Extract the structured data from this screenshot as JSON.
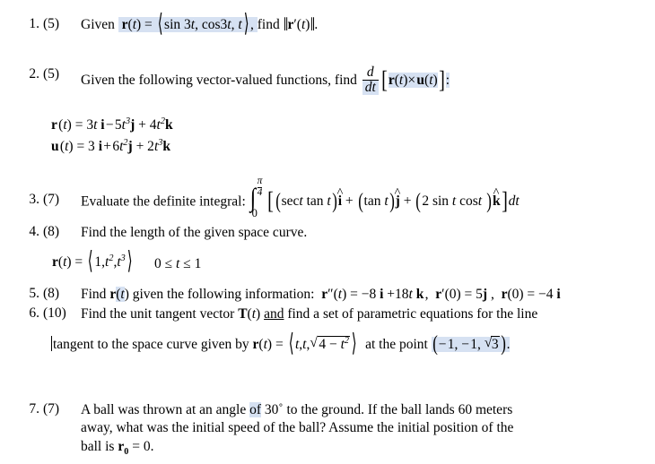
{
  "document": {
    "type": "math-worksheet",
    "background_color": "#ffffff",
    "text_color": "#000000",
    "highlight_color": "#d6e1f2"
  },
  "problems": [
    {
      "number": "1.",
      "points": "(5)",
      "text_before": "Given",
      "expression": "r(t) = ⟨sin 3t, cos3t, t⟩,",
      "text_after": "find",
      "expression2": "‖r′(t)‖.",
      "highlighted": true
    },
    {
      "number": "2.",
      "points": "(5)",
      "text_before": "Given the following vector-valued functions, find",
      "fraction_numerator": "d",
      "fraction_denominator": "dt",
      "expression": "[r(t)× u(t)]:",
      "highlighted": true,
      "given_functions": [
        "r(t) = 3t i − 5t³j + 4t²k",
        "u(t) = 3 i + 6t²j + 2t³k"
      ]
    },
    {
      "number": "3.",
      "points": "(7)",
      "text_before": "Evaluate the definite integral:",
      "integral_lower": "0",
      "integral_upper": "π/4",
      "integrand": "[(sect tan t)î + (tan t)ĵ + (2 sin t cost )k̂]dt"
    },
    {
      "number": "4.",
      "points": "(8)",
      "text_before": "Find the length of the given space curve.",
      "curve": "r(t) = ⟨1,t²,t³⟩",
      "domain": "0 ≤ t ≤ 1"
    },
    {
      "number": "5.",
      "points": "(8)",
      "text_before": "Find r(t) given the following information:",
      "given": "r\"(t) = −8 i +18t k ,   r′(0) = 5j ,   r(0) = −4 i"
    },
    {
      "number": "6.",
      "points": "(10)",
      "line1_a": "Find the unit tangent vector T(t) ",
      "line1_underlined": "and",
      "line1_b": " find a set of parametric equations for the line",
      "line2_a": "tangent to the space curve given by ",
      "line2_curve": "r(t) = ⟨t,t,√(4 − t²)⟩",
      "line2_b": " at the point ",
      "line2_point": "(−1, −1, √3).",
      "has_caret": true,
      "point_highlighted": true
    },
    {
      "number": "7.",
      "points": "(7)",
      "line1_a": "A ball was thrown at an angle ",
      "line1_highlight": "of",
      "line1_b": " 30˚ to the ground.  If the ball lands 60 meters",
      "line2": "away, what was the initial speed of the ball?  Assume the initial position of the",
      "line3_a": "ball is ",
      "line3_b": "r",
      "line3_sub": "0",
      "line3_c": " = 0."
    }
  ]
}
